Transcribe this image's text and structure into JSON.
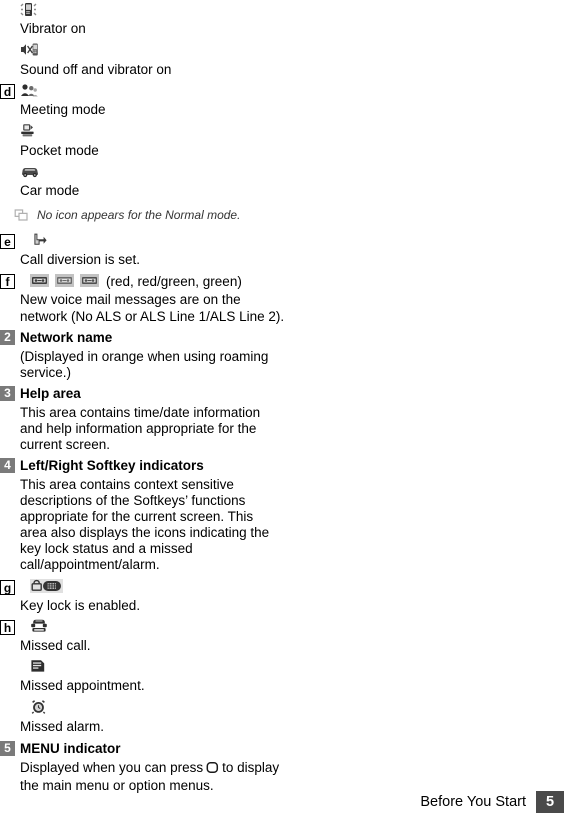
{
  "document": {
    "footer": {
      "section_label": "Before You Start",
      "page_number": "5"
    }
  },
  "entries": [
    {
      "marker": "",
      "marker_type": "none",
      "icon": "vibrator-on-icon",
      "caption": "Vibrator on"
    },
    {
      "marker": "",
      "marker_type": "none",
      "icon": "sound-off-vibrator-on-icon",
      "caption": "Sound off and vibrator on"
    },
    {
      "marker": "d",
      "marker_type": "letter",
      "icon": "meeting-mode-icon",
      "caption": "Meeting mode"
    },
    {
      "marker": "",
      "marker_type": "none",
      "icon": "pocket-mode-icon",
      "caption": "Pocket mode"
    },
    {
      "marker": "",
      "marker_type": "none",
      "icon": "car-mode-icon",
      "caption": "Car mode"
    }
  ],
  "note": {
    "icon": "memo-note-icon",
    "text": "No icon appears for the Normal mode."
  },
  "entry_e": {
    "marker": "e",
    "icon": "call-diversion-icon",
    "caption": "Call diversion is set."
  },
  "entry_f": {
    "marker": "f",
    "icons": [
      "voicemail-red-icon",
      "voicemail-red-green-icon",
      "voicemail-green-icon"
    ],
    "icon_legend": "(red, red/green, green)",
    "caption_line1": "New voice mail messages are on the",
    "caption_line2": "network (No ALS or ALS Line 1/ALS Line 2)."
  },
  "sections": [
    {
      "number": "2",
      "title": "Network name",
      "body": "(Displayed in orange when using roaming service.)"
    },
    {
      "number": "3",
      "title": "Help area",
      "body": "This area contains time/date information and help information appropriate for the current screen."
    },
    {
      "number": "4",
      "title": "Left/Right Softkey indicators",
      "body": "This area contains context sensitive descriptions of the Softkeys’ functions appropriate for the current screen. This area also displays the icons indicating the key lock status and a missed call/appointment/alarm."
    }
  ],
  "entry_g": {
    "marker": "g",
    "icon": "key-lock-icon",
    "caption": "Key lock is enabled."
  },
  "entry_h": {
    "marker": "h",
    "icon": "missed-call-icon",
    "caption": "Missed call."
  },
  "entry_missed_appointment": {
    "icon": "missed-appointment-icon",
    "caption": "Missed appointment."
  },
  "entry_missed_alarm": {
    "icon": "missed-alarm-icon",
    "caption": "Missed alarm."
  },
  "section_menu": {
    "number": "5",
    "title": "MENU indicator",
    "body_part1": "Displayed when you can press",
    "body_glyph": "menu-key-icon",
    "body_part2": "to display the main menu or option menus."
  },
  "colors": {
    "marker_gray": "#7a7a7a",
    "footer_gray": "#4a4a4a",
    "icon_box_gray": "#bdbdbd",
    "text_black": "#000000"
  }
}
